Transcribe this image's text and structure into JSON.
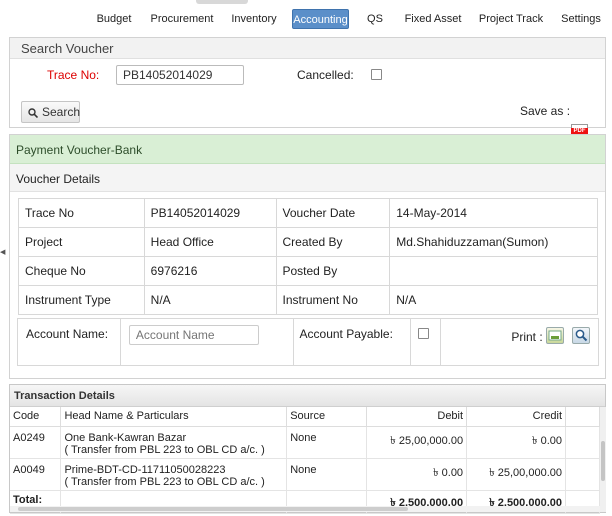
{
  "nav": {
    "items": [
      {
        "label": "Budget",
        "active": false
      },
      {
        "label": "Procurement",
        "active": false
      },
      {
        "label": "Inventory",
        "active": false
      },
      {
        "label": "Accounting",
        "active": true
      },
      {
        "label": "QS",
        "active": false
      },
      {
        "label": "Fixed Asset",
        "active": false
      },
      {
        "label": "Project Track",
        "active": false
      },
      {
        "label": "Settings",
        "active": false
      }
    ]
  },
  "search": {
    "title": "Search Voucher",
    "trace_label": "Trace No:",
    "trace_value": "PB14052014029",
    "cancelled_label": "Cancelled:",
    "search_button": "Search",
    "save_as_label": "Save as :",
    "pdf_icon": "pdf-icon"
  },
  "voucher": {
    "title": "Payment Voucher-Bank",
    "details_title": "Voucher Details",
    "rows": [
      [
        "Trace No",
        "PB14052014029",
        "Voucher Date",
        "14-May-2014"
      ],
      [
        "Project",
        "Head Office",
        "Created By",
        "Md.Shahiduzzaman(Sumon)"
      ],
      [
        "Cheque No",
        "6976216",
        "Posted By",
        ""
      ],
      [
        "Instrument Type",
        "N/A",
        "Instrument No",
        "N/A"
      ]
    ],
    "account_name_label": "Account Name:",
    "account_name_placeholder": "Account Name",
    "account_payable_label": "Account Payable:",
    "print_label": "Print :"
  },
  "transactions": {
    "title": "Transaction Details",
    "columns": [
      "Code",
      "Head Name & Particulars",
      "Source",
      "Debit",
      "Credit"
    ],
    "rows": [
      {
        "code": "A0249",
        "head": "One Bank-Kawran Bazar",
        "particulars": "( Transfer from PBL 223 to OBL CD a/c. )",
        "source": "None",
        "debit": "৳ 25,00,000.00",
        "credit": "৳ 0.00"
      },
      {
        "code": "A0049",
        "head": "Prime-BDT-CD-11711050028223",
        "particulars": "( Transfer from PBL 223 to OBL CD a/c. )",
        "source": "None",
        "debit": "৳ 0.00",
        "credit": "৳ 25,00,000.00"
      }
    ],
    "total_label": "Total:",
    "total_debit": "৳ 2,500,000.00",
    "total_credit": "৳ 2,500,000.00"
  }
}
